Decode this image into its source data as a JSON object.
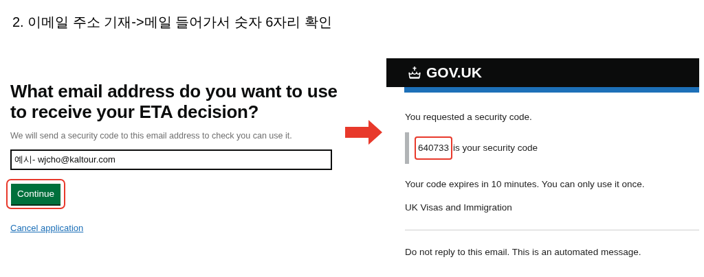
{
  "caption": "2. 이메일 주소 기재->메일 들어가서 숫자 6자리 확인",
  "form": {
    "heading": "What email address do you want to use to receive your ETA decision?",
    "hint": "We will send a security code to this email address to check you can use it.",
    "email_field": {
      "value": "예시- wjcho@kaltour.com"
    },
    "continue_button": {
      "label": "Continue",
      "highlighted": true
    },
    "cancel_link": "Cancel application"
  },
  "email": {
    "brand": "GOV.UK",
    "intro": "You requested a security code.",
    "code": {
      "value": "640733",
      "highlighted": true
    },
    "code_text": "is your security code",
    "expiry": "Your code expires in 10 minutes. You can only use it once.",
    "sender": "UK Visas and Immigration",
    "footer": "Do not reply to this email. This is an automated message."
  }
}
